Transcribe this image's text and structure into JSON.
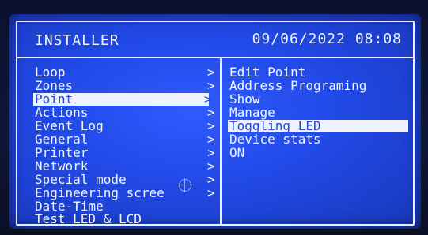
{
  "header": {
    "title": "INSTALLER",
    "datetime": "09/06/2022 08:08"
  },
  "menu": {
    "items": [
      {
        "label": "Loop",
        "arrow": ">"
      },
      {
        "label": "Zones",
        "arrow": ">"
      },
      {
        "label": "Point",
        "arrow": ">"
      },
      {
        "label": "Actions",
        "arrow": ">"
      },
      {
        "label": "Event Log",
        "arrow": ">"
      },
      {
        "label": "General",
        "arrow": ">"
      },
      {
        "label": "Printer",
        "arrow": ">"
      },
      {
        "label": "Network",
        "arrow": ">"
      },
      {
        "label": "Special mode",
        "arrow": ">"
      },
      {
        "label": "Engineering scree",
        "arrow": ">"
      },
      {
        "label": "Date-Time",
        "arrow": ""
      },
      {
        "label": "Test LED & LCD",
        "arrow": ""
      }
    ],
    "selected_index": 2
  },
  "submenu": {
    "items": [
      "Edit Point",
      "Address Programing",
      "Show",
      "Manage",
      "Toggling LED",
      "Device stats",
      "ON"
    ],
    "selected_index": 4
  },
  "colors": {
    "screen": "#2149e6",
    "text": "#f2f6ff",
    "highlight_bg": "#eef2ff",
    "highlight_text": "#2447d8"
  }
}
